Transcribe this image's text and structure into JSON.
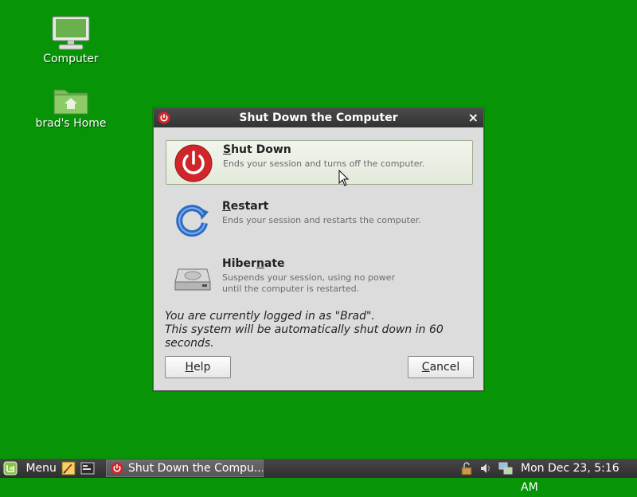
{
  "desktop": {
    "icons": [
      {
        "label": "Computer",
        "icon": "computer-icon"
      },
      {
        "label": "brad's Home",
        "icon": "home-folder-icon"
      }
    ]
  },
  "dialog": {
    "title": "Shut Down the Computer",
    "close_glyph": "×",
    "options": [
      {
        "mnemonic": "S",
        "title_rest": "hut Down",
        "description": "Ends your session and turns off the computer.",
        "selected": true
      },
      {
        "mnemonic": "R",
        "title_rest": "estart",
        "description": "Ends your session and restarts the computer.",
        "selected": false
      },
      {
        "title_pre": "Hiber",
        "mnemonic": "n",
        "title_rest": "ate",
        "description_line1": "Suspends your session, using no power",
        "description_line2": "until the computer is restarted.",
        "selected": false
      }
    ],
    "status_line1": "You are currently logged in as \"Brad\".",
    "status_line2": "This system will be automatically shut down in 60 seconds.",
    "help": {
      "mnemonic": "H",
      "rest": "elp"
    },
    "cancel": {
      "mnemonic": "C",
      "rest": "ancel"
    }
  },
  "taskbar": {
    "menu_label": "Menu",
    "task_label": "Shut Down the Compu...",
    "clock": "Mon Dec 23,  5:16 AM"
  },
  "colors": {
    "desktop": "#079407",
    "shutdown_red": "#d0262b",
    "restart_blue": "#2e6bc4"
  }
}
